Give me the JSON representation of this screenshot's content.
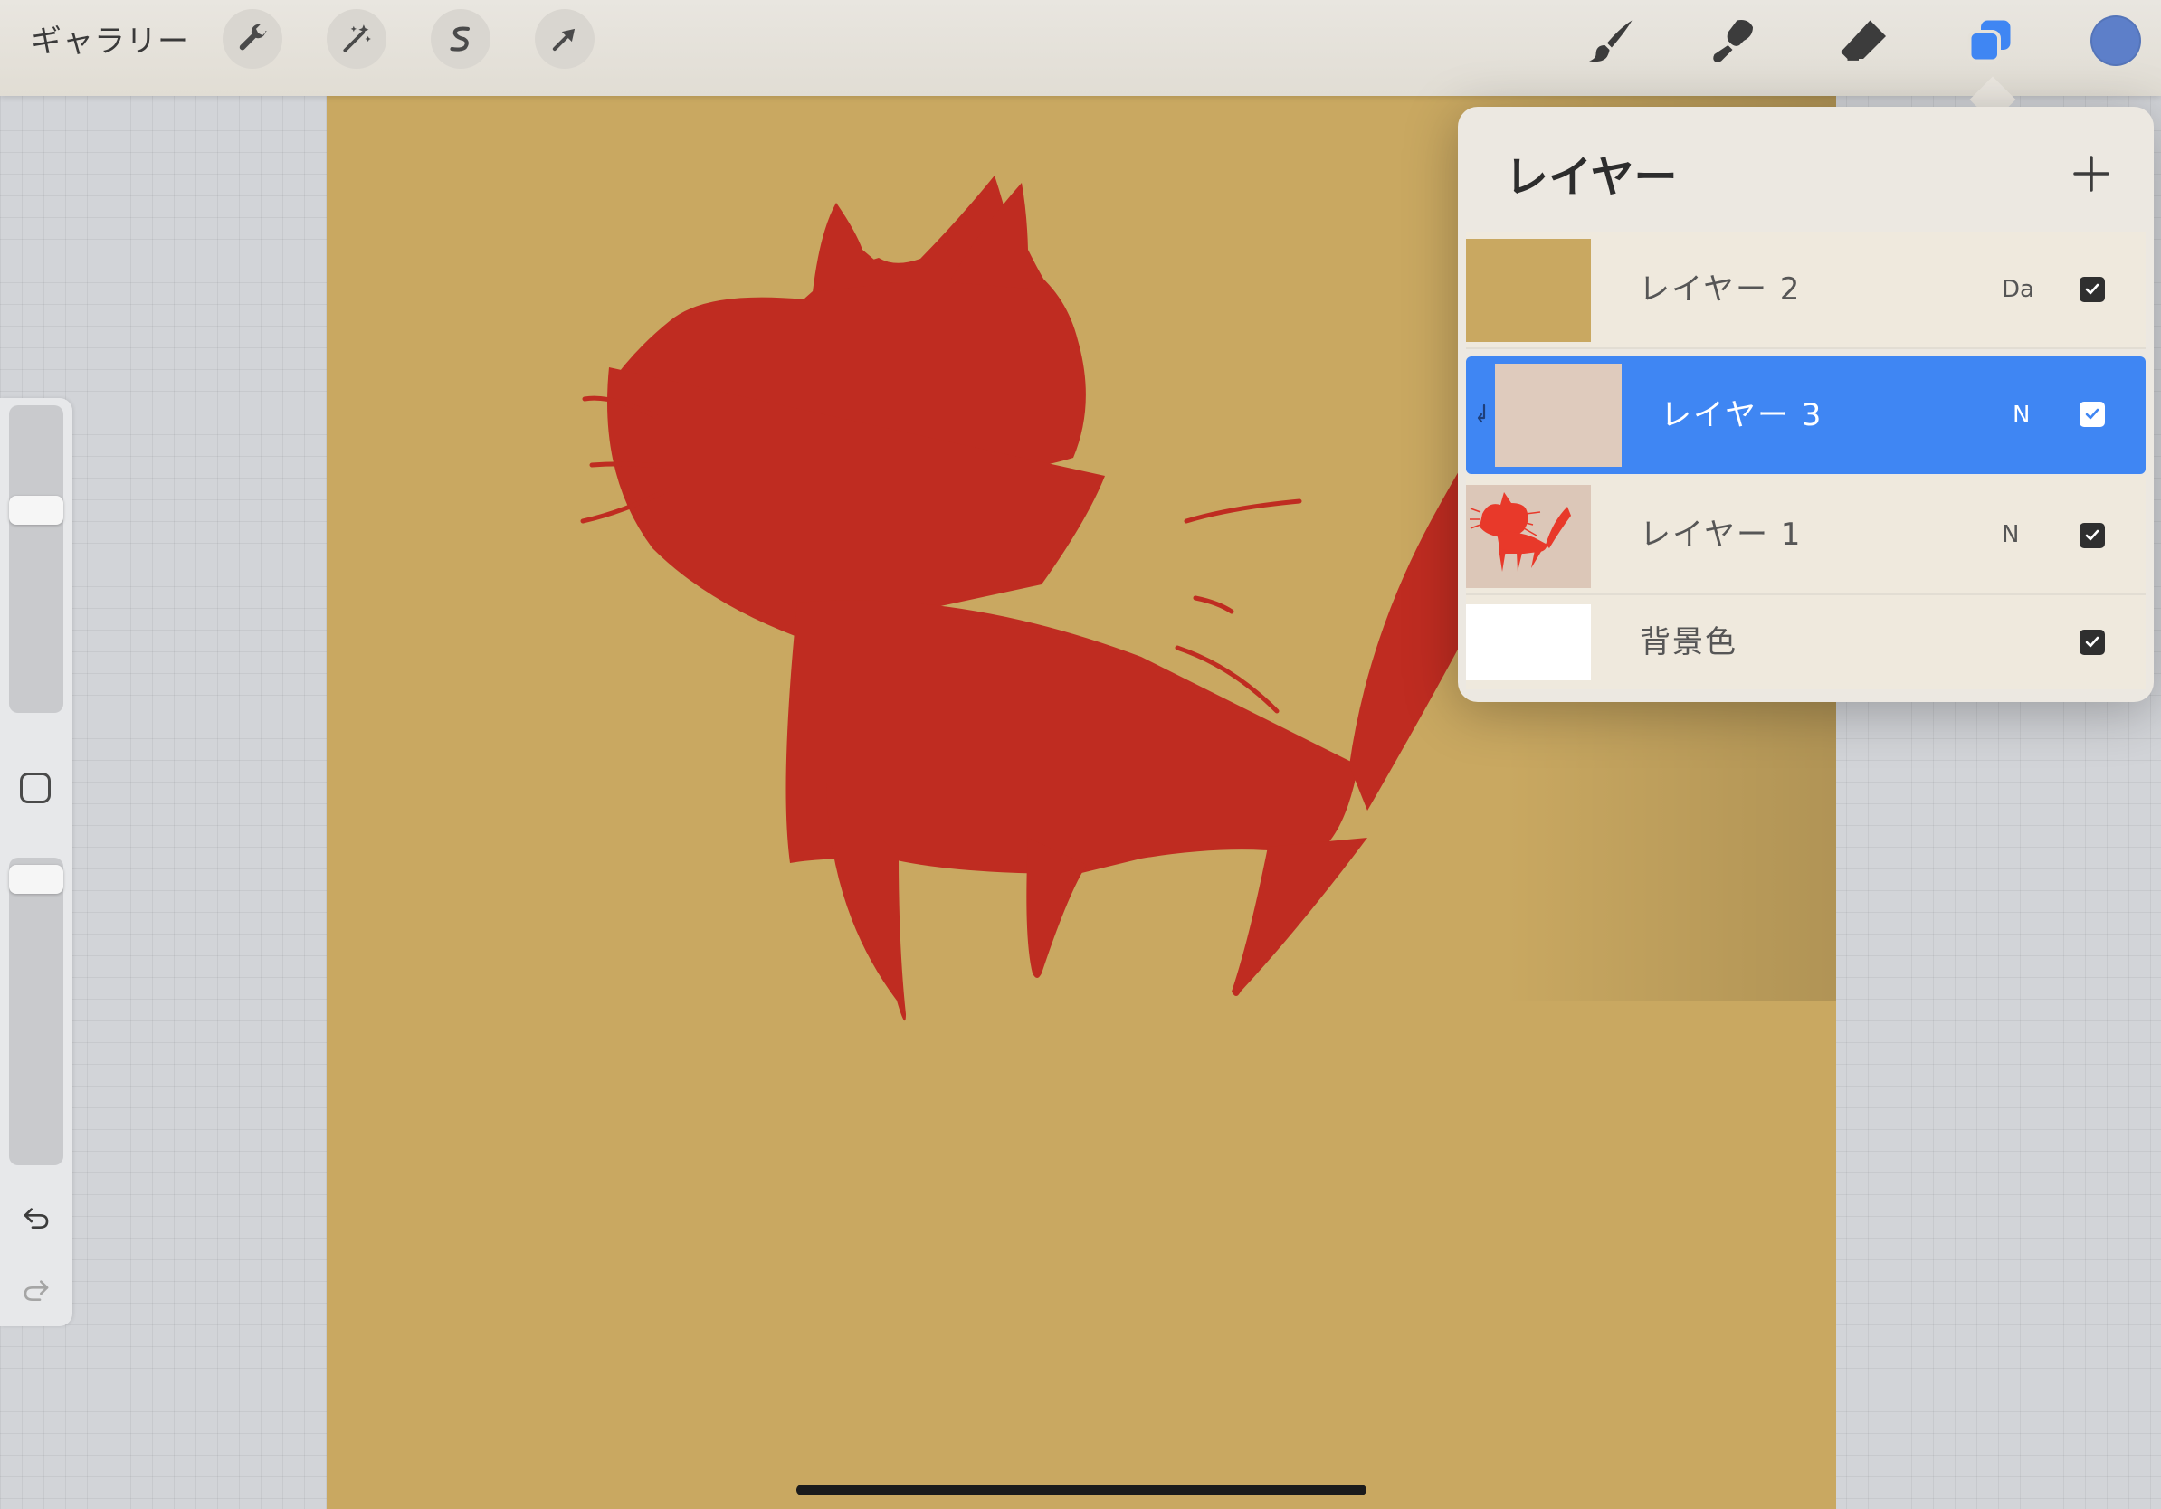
{
  "toolbar": {
    "gallery_label": "ギャラリー",
    "left_tools": [
      {
        "icon": "wrench-icon"
      },
      {
        "icon": "magic-wand-icon"
      },
      {
        "icon": "selection-s-icon"
      },
      {
        "icon": "transform-arrow-icon"
      }
    ],
    "right_tools": [
      {
        "icon": "brush-icon"
      },
      {
        "icon": "smudge-icon"
      },
      {
        "icon": "eraser-icon"
      },
      {
        "icon": "layers-icon"
      }
    ],
    "current_color": "#5d7fc9",
    "accent_color": "#3f86f3"
  },
  "sidebar": {
    "brush_size_level": 0.3,
    "opacity_level": 0.95,
    "modifier_icon": "square-modifier-icon",
    "undo_icon": "undo-icon",
    "redo_icon": "redo-icon"
  },
  "canvas": {
    "background_color": "#c9a861",
    "drawing_color": "#bf2c21"
  },
  "layers_panel": {
    "title": "レイヤー",
    "add_icon": "plus-icon",
    "layers": [
      {
        "name": "レイヤー 2",
        "blend": "Da",
        "visible": true,
        "active": false,
        "thumb": "gold"
      },
      {
        "name": "レイヤー 3",
        "blend": "N",
        "visible": true,
        "active": true,
        "thumb": "blank",
        "clipped": true
      },
      {
        "name": "レイヤー 1",
        "blend": "N",
        "visible": true,
        "active": false,
        "thumb": "cat"
      },
      {
        "name": "背景色",
        "blend": "",
        "visible": true,
        "active": false,
        "thumb": "white"
      }
    ]
  }
}
